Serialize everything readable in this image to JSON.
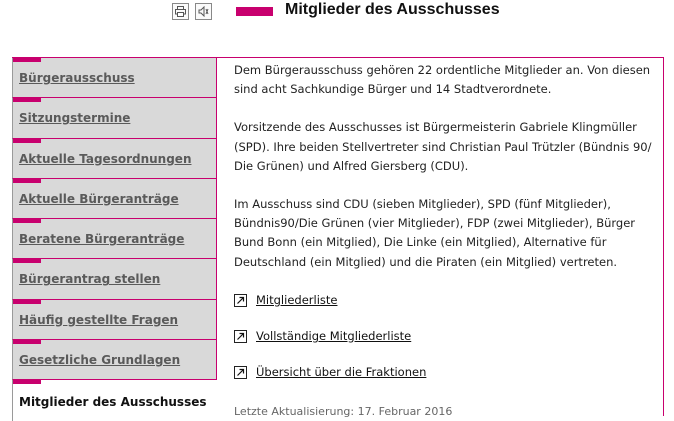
{
  "toolbar": {
    "print_icon": "printer-icon",
    "audio_icon": "speaker-icon"
  },
  "header": {
    "title": "Mitglieder des Ausschusses"
  },
  "sidebar": {
    "items": [
      {
        "label": "Bürgerausschuss"
      },
      {
        "label": "Sitzungstermine"
      },
      {
        "label": "Aktuelle Tagesordnungen"
      },
      {
        "label": "Aktuelle Bürgeranträge"
      },
      {
        "label": "Beratene Bürgeranträge"
      },
      {
        "label": "Bürgerantrag stellen"
      },
      {
        "label": "Häufig gestellte Fragen"
      },
      {
        "label": "Gesetzliche Grundlagen"
      },
      {
        "label": "Mitglieder des Ausschusses"
      }
    ]
  },
  "content": {
    "paragraphs": [
      "Dem Bürgerausschuss gehören 22 ordentliche Mitglieder an. Von diesen sind acht Sachkundige Bürger und 14 Stadtverordnete.",
      "Vorsitzende des Ausschusses ist Bürgermeisterin Gabriele Klingmüller (SPD). Ihre beiden Stellvertreter sind Christian Paul Trützler (Bündnis 90/ Die Grünen) und Alfred Giersberg (CDU).",
      "Im Ausschuss sind CDU (sieben Mitglieder), SPD (fünf Mitglieder), Bündnis90/Die Grünen (vier Mitglieder), FDP (zwei Mitglieder), Bürger Bund Bonn (ein Mitglied), Die Linke (ein Mitglied), Alternative für Deutschland (ein Mitglied) und die Piraten (ein Mitglied) vertreten."
    ],
    "links": [
      {
        "label": "Mitgliederliste"
      },
      {
        "label": "Vollständige Mitgliederliste"
      },
      {
        "label": "Übersicht über die Fraktionen"
      }
    ],
    "last_update": "Letzte Aktualisierung: 17. Februar 2016"
  },
  "colors": {
    "accent": "#c8006e",
    "nav_background": "#d9d9d9"
  }
}
